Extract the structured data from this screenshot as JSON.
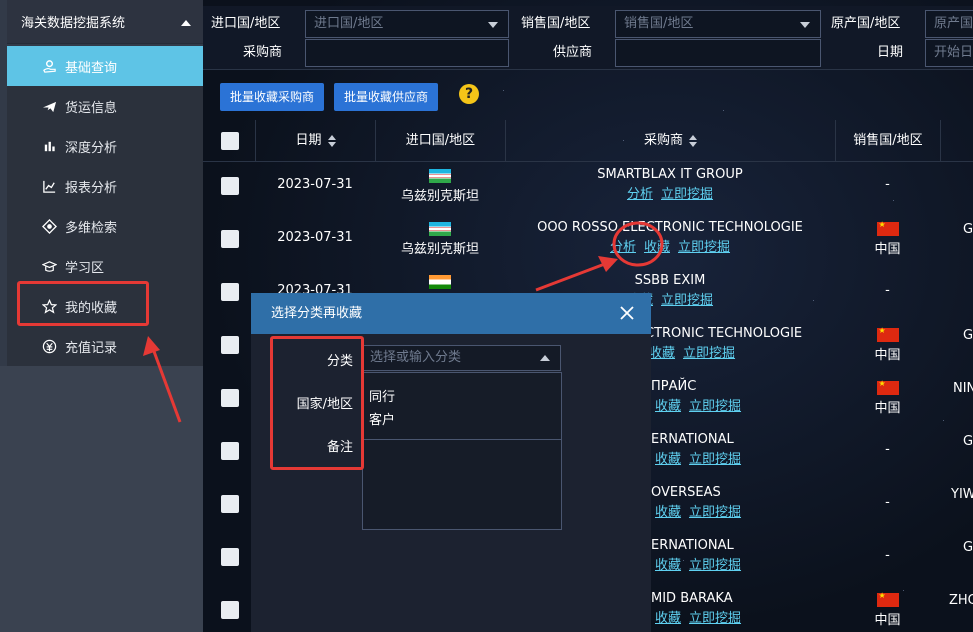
{
  "sidebar": {
    "system_title": "海关数据挖掘系统",
    "items": [
      {
        "label": "基础查询",
        "icon": "hand-coins-icon",
        "active": true
      },
      {
        "label": "货运信息",
        "icon": "airplane-icon",
        "active": false
      },
      {
        "label": "深度分析",
        "icon": "analysis-icon",
        "active": false
      },
      {
        "label": "报表分析",
        "icon": "bar-chart-icon",
        "active": false
      },
      {
        "label": "多维检索",
        "icon": "multi-search-icon",
        "active": false
      },
      {
        "label": "学习区",
        "icon": "graduation-cap-icon",
        "active": false
      },
      {
        "label": "我的收藏",
        "icon": "star-icon",
        "active": false
      },
      {
        "label": "充值记录",
        "icon": "currency-icon",
        "active": false
      }
    ]
  },
  "filters": {
    "import_country_label": "进口国/地区",
    "import_country_placeholder": "进口国/地区",
    "sales_country_label": "销售国/地区",
    "sales_country_placeholder": "销售国/地区",
    "origin_country_label": "原产国/地区",
    "origin_country_placeholder": "原产国",
    "buyer_label": "采购商",
    "supplier_label": "供应商",
    "date_label": "日期",
    "date_placeholder": "开始日"
  },
  "toolbar": {
    "bulk_fav_buyer": "批量收藏采购商",
    "bulk_fav_supplier": "批量收藏供应商",
    "help": "?"
  },
  "table": {
    "headers": {
      "date": "日期",
      "import_country": "进口国/地区",
      "buyer": "采购商",
      "sales_country": "销售国/地区"
    },
    "analyze_label": "分析",
    "favorite_label": "收藏",
    "mine_label": "立即挖掘",
    "rows": [
      {
        "date": "2023-07-31",
        "import_country": "乌兹别克斯坦",
        "buyer": "SMARTBLAX IT GROUP",
        "sales_country": "-",
        "extra": ""
      },
      {
        "date": "2023-07-31",
        "import_country": "乌兹别克斯坦",
        "buyer": "OOO ROSSO ELECTRONIC TECHNOLOGIE",
        "sales_country": "中国",
        "extra": "G"
      },
      {
        "date": "2023-07-31",
        "import_country": "",
        "buyer": "SSBB EXIM",
        "sales_country": "-",
        "extra": ""
      },
      {
        "date": "",
        "import_country": "",
        "buyer": "CTRONIC TECHNOLOGIE",
        "sales_country": "中国",
        "extra": "G"
      },
      {
        "date": "",
        "import_country": "",
        "buyer": "ПРАЙС",
        "sales_country": "中国",
        "extra": "NIN"
      },
      {
        "date": "",
        "import_country": "",
        "buyer": "ERNATIONAL",
        "sales_country": "-",
        "extra": "G"
      },
      {
        "date": "",
        "import_country": "",
        "buyer": "OVERSEAS",
        "sales_country": "-",
        "extra": "YIW"
      },
      {
        "date": "",
        "import_country": "",
        "buyer": "ERNATIONAL",
        "sales_country": "-",
        "extra": "G"
      },
      {
        "date": "",
        "import_country": "",
        "buyer": "MID BARAKA",
        "sales_country": "中国",
        "extra": "ZHO"
      }
    ]
  },
  "modal": {
    "title": "选择分类再收藏",
    "category_label": "分类",
    "country_label": "国家/地区",
    "note_label": "备注",
    "category_placeholder": "选择或输入分类",
    "options": [
      "同行",
      "客户"
    ]
  },
  "colors": {
    "accent": "#5ec4e6",
    "button": "#2b73d6",
    "annotation": "#e53935",
    "link": "#5fd0f0"
  }
}
